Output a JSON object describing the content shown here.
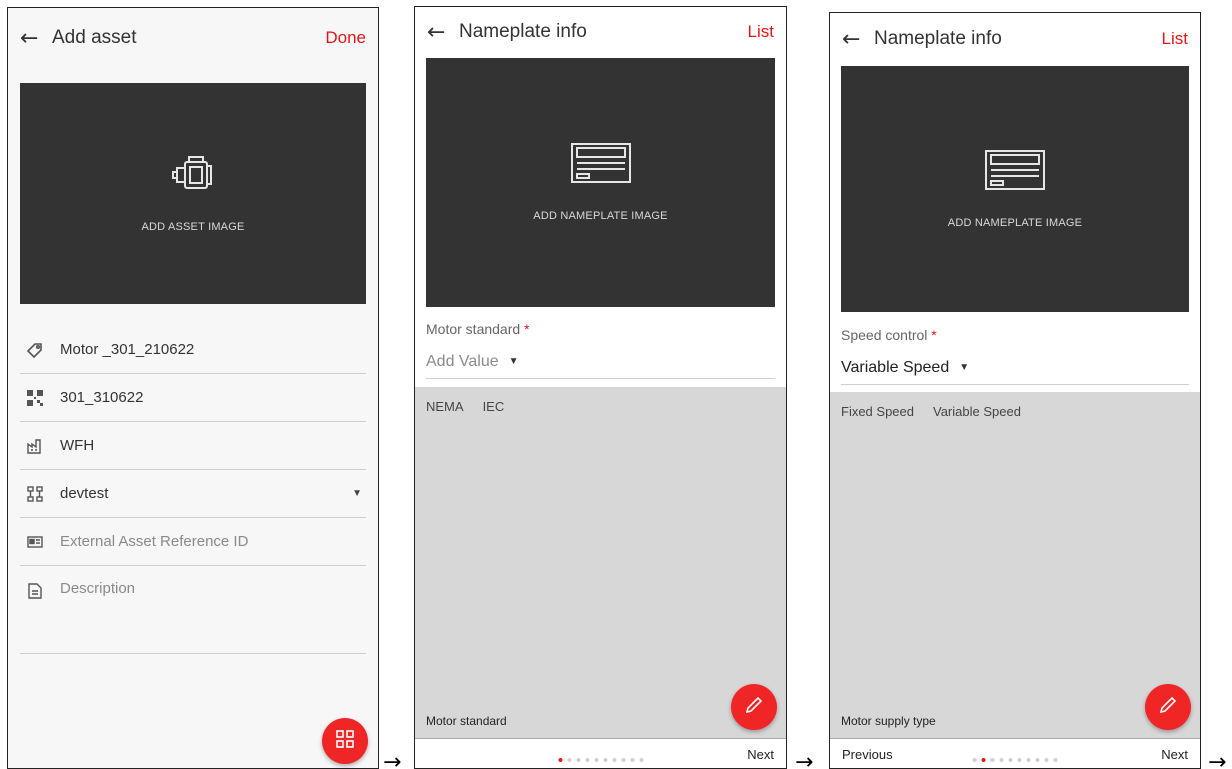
{
  "screen1": {
    "title": "Add asset",
    "action": "Done",
    "image_label": "ADD ASSET IMAGE",
    "fields": [
      {
        "icon": "tag-icon",
        "value": "Motor _301_210622",
        "placeholder": false
      },
      {
        "icon": "qr-code-icon",
        "value": "301_310622",
        "placeholder": false
      },
      {
        "icon": "factory-icon",
        "value": "WFH",
        "placeholder": false
      },
      {
        "icon": "hierarchy-icon",
        "value": "devtest",
        "placeholder": false
      },
      {
        "icon": "id-card-icon",
        "value": "External Asset Reference ID",
        "placeholder": true
      },
      {
        "icon": "document-icon",
        "value": "Description",
        "placeholder": true
      }
    ],
    "fab_icon": "qr-scan-icon"
  },
  "screen2": {
    "title": "Nameplate info",
    "action": "List",
    "image_label": "ADD NAMEPLATE IMAGE",
    "field_label": "Motor standard",
    "required_mark": "*",
    "field_value": "Add Value",
    "options": [
      "NEMA",
      "IEC"
    ],
    "panel_footer": "Motor standard",
    "next": "Next",
    "active_page": 0,
    "page_count": 10
  },
  "screen3": {
    "title": "Nameplate info",
    "action": "List",
    "image_label": "ADD NAMEPLATE IMAGE",
    "field_label": "Speed control",
    "required_mark": "*",
    "field_value": "Variable Speed",
    "options": [
      "Fixed Speed",
      "Variable Speed"
    ],
    "panel_footer": "Motor supply type",
    "previous": "Previous",
    "next": "Next",
    "active_page": 1,
    "page_count": 10
  },
  "flow_arrow": "→",
  "colors": {
    "accent": "#e3161c",
    "fab": "#f02626",
    "image_bg": "#333333",
    "panel_bg": "#d7d7d7"
  }
}
